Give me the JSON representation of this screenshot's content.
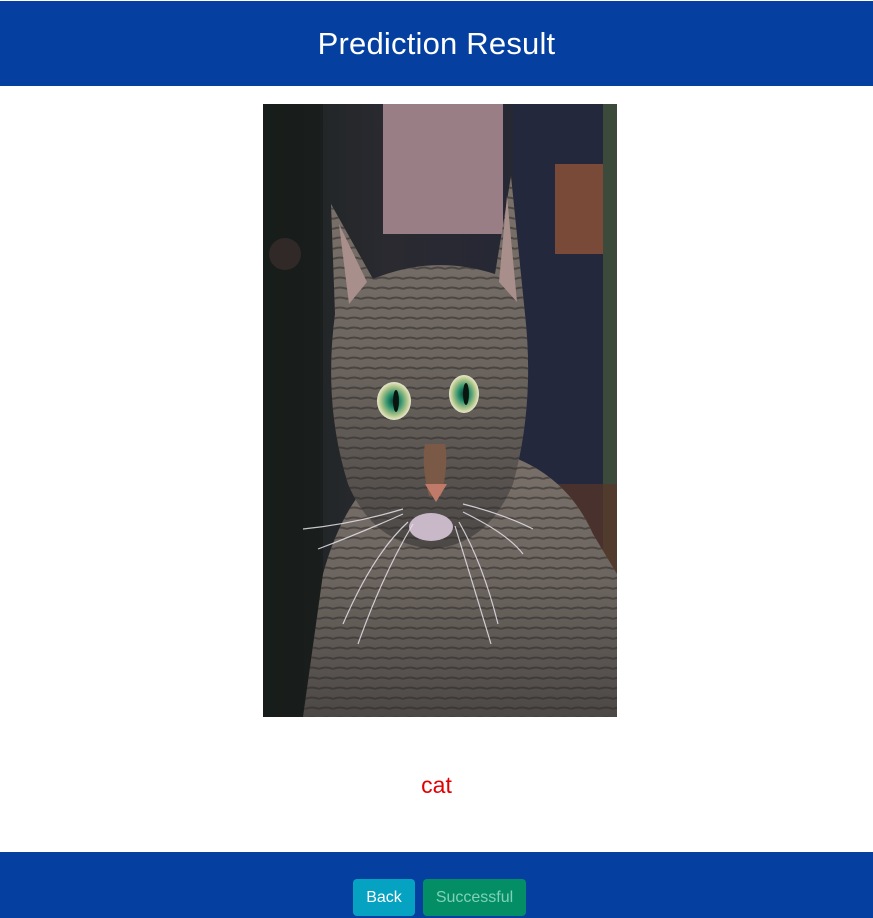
{
  "header": {
    "title": "Prediction Result"
  },
  "image": {
    "alt": "Uploaded image of a tabby cat"
  },
  "result": {
    "label": "cat",
    "color": "#e00000"
  },
  "footer": {
    "back_label": "Back",
    "status_label": "Successful"
  },
  "colors": {
    "bar": "#0540a0",
    "back_button": "#06a2c2",
    "back_text": "#ffffff",
    "status_button": "#048e66",
    "status_text": "#7fd2b6"
  }
}
